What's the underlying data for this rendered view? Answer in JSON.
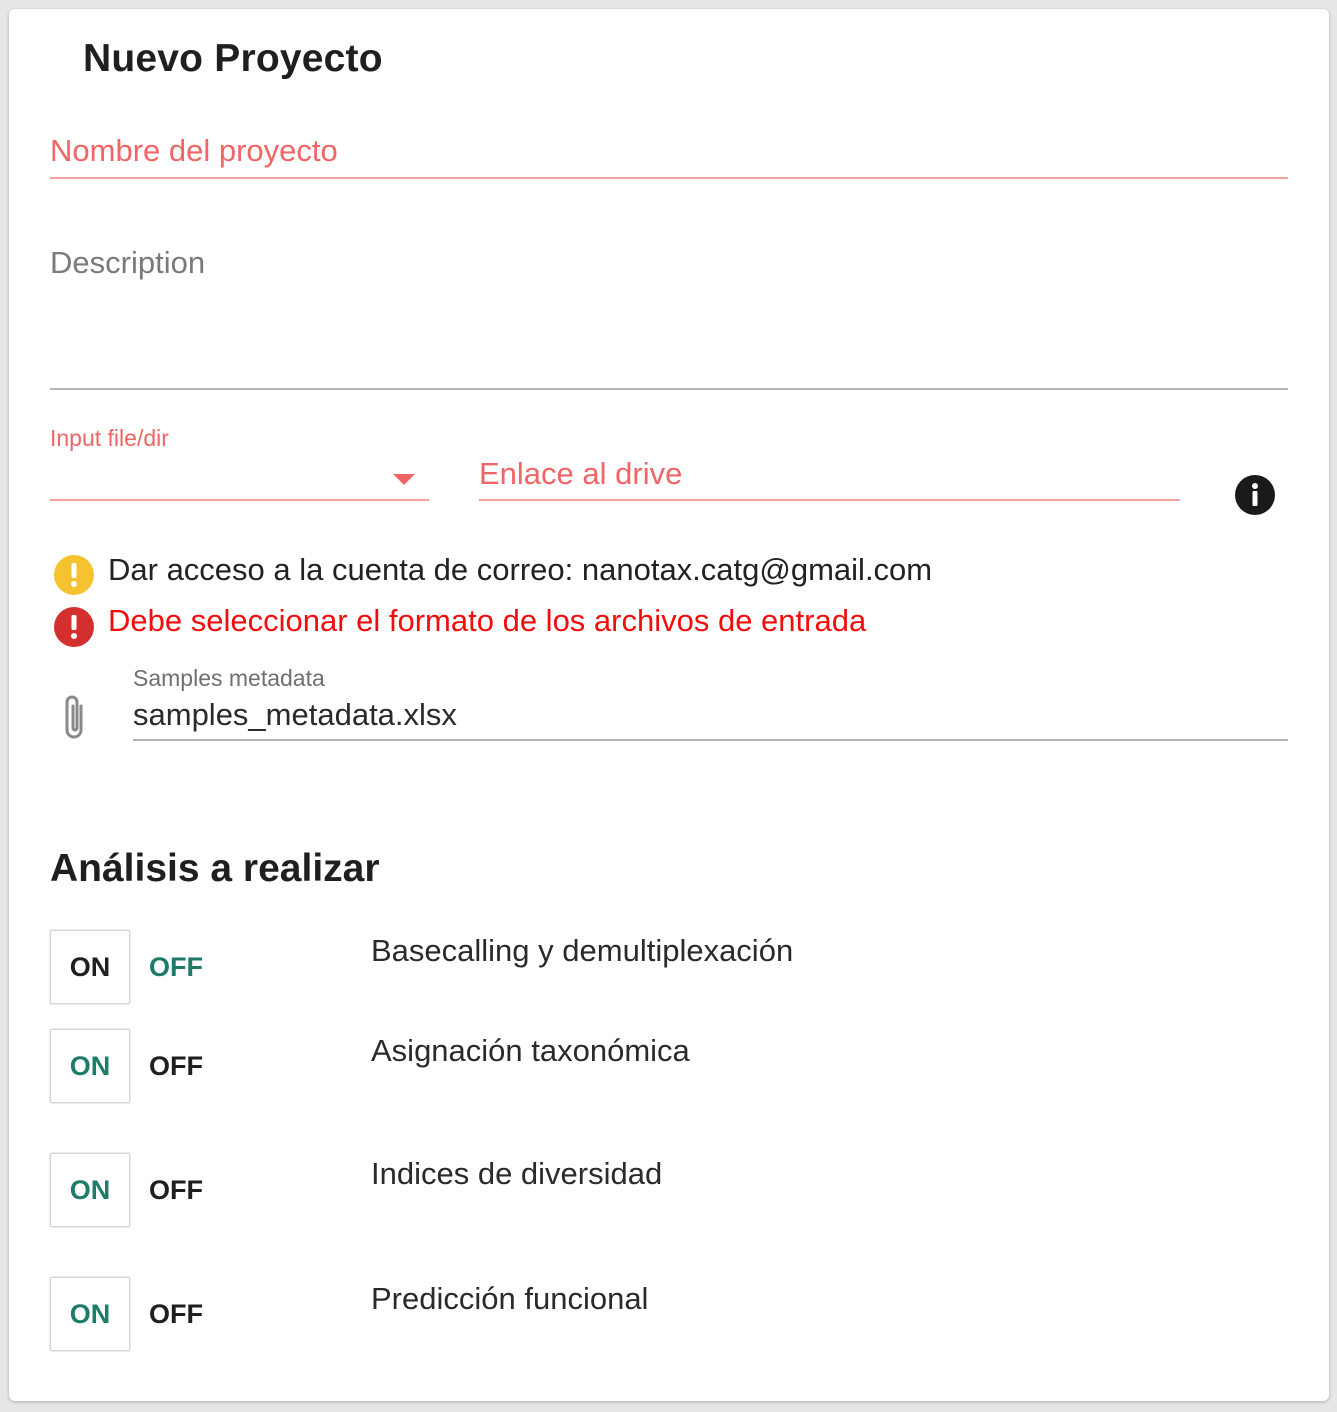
{
  "form": {
    "title": "Nuevo Proyecto",
    "project_name_label": "Nombre del proyecto",
    "description_label": "Description",
    "input_label": "Input file/dir",
    "drive_label": "Enlace al drive",
    "warning_text": "Dar acceso a la cuenta de correo: nanotax.catg@gmail.com",
    "error_text": "Debe seleccionar el formato de los archivos de entrada",
    "metadata_label": "Samples metadata",
    "metadata_value": "samples_metadata.xlsx"
  },
  "analysis": {
    "title": "Análisis a realizar",
    "rows": [
      {
        "label": "Basecalling y demultiplexación",
        "on": "ON",
        "off": "OFF",
        "state": "on"
      },
      {
        "label": "Asignación taxonómica",
        "on": "ON",
        "off": "OFF",
        "state": "off"
      },
      {
        "label": "Indices de diversidad",
        "on": "ON",
        "off": "OFF",
        "state": "off"
      },
      {
        "label": "Predicción funcional",
        "on": "ON",
        "off": "OFF",
        "state": "off"
      }
    ]
  },
  "colors": {
    "error_red": "#f06565",
    "error_text_red": "#f20d0d",
    "warning_yellow": "#f7c22f",
    "error_icon_red": "#d32f2f",
    "toggle_teal": "#1f7a6a"
  },
  "icons": {
    "select": "chevron-down-icon",
    "info": "info-icon",
    "warning": "warning-icon",
    "error": "error-icon",
    "attachment": "paperclip-icon"
  }
}
